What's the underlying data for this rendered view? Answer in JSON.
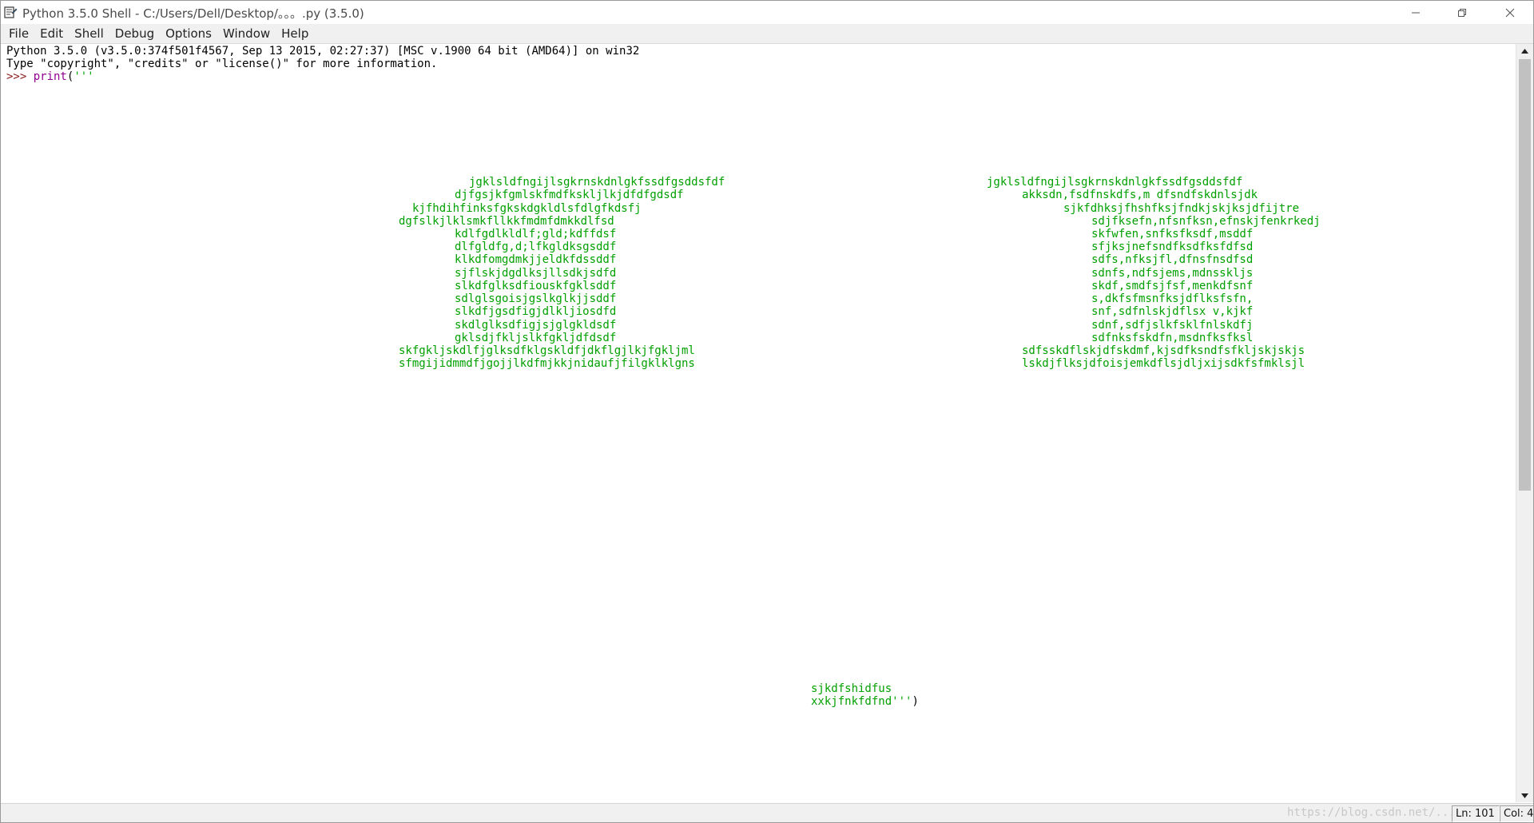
{
  "window": {
    "title": "Python 3.5.0 Shell - C:/Users/Dell/Desktop/。。。.py (3.5.0)"
  },
  "menu": {
    "items": [
      "File",
      "Edit",
      "Shell",
      "Debug",
      "Options",
      "Window",
      "Help"
    ]
  },
  "shell": {
    "banner_1": "Python 3.5.0 (v3.5.0:374f501f4567, Sep 13 2015, 02:27:37) [MSC v.1900 64 bit (AMD64)] on win32",
    "banner_2": "Type \"copyright\", \"credits\" or \"license()\" for more information.",
    "prompt": ">>> ",
    "call_fn": "print",
    "call_open": "(",
    "call_quote": "'''",
    "left_block": [
      "jgklsldfngijlsgkrnskdnlgkfssdfgsddsfdf",
      "djfgsjkfgmlskfmdfkskljlkjdfdfgdsdf",
      "kjfhdihfinksfgkskdgkldlsfdlgfkdsfj",
      "dgfslkjlklsmkfllkkfmdmfdmkkdlfsd",
      "kdlfgdlkldlf;gld;kdffdsf",
      "dlfgldfg,d;lfkgldksgsddf",
      "klkdfomgdmkjjeldkfdssddf",
      "sjflskjdgdlksjllsdkjsdfd",
      "slkdfglksdfiouskfgklsddf",
      "sdlglsgoisjgslkglkjjsddf",
      "slkdfjgsdfigjdlkljiosdfd",
      "skdlglksdfigjsjglgkldsdf",
      "gklsdjfkljslkfgkljdfdsdf",
      "skfgkljskdlfjglksdfklgskldfjdkflgjlkjfgkljml",
      "sfmgijidmmdfjgojjlkdfmjkkjnidaufjfilgklklgns"
    ],
    "right_block": [
      "jgklsldfngijlsgkrnskdnlgkfssdfgsddsfdf",
      "akksdn,fsdfnskdfs,m dfsndfskdnlsjdk",
      "sjkfdhksjfhshfksjfndkjskjksjdfijtre",
      "sdjfksefn,nfsnfksn,efnskjfenkrkedj",
      "skfwfen,snfksfksdf,msddf",
      "sfjksjnefsndfksdfksfdfsd",
      "sdfs,nfksjfl,dfnsfnsdfsd",
      "sdnfs,ndfsjems,mdnsskljs",
      "skdf,smdfsjfsf,menkdfsnf",
      "s,dkfsfmsnfksjdflksfsfn,",
      "snf,sdfnlskjdflsx v,kjkf",
      "sdnf,sdfjslkfsklfnlskdfj",
      "sdfnksfskdfn,msdnfksfksl",
      "sdfsskdflskjdfskdmf,kjsdfksndfsfkljskjskjs",
      "lskdjflksjdfoisjemkdflsjdljxijsdkfsfmklsjl"
    ],
    "tail_1": "sjkdfshidfus",
    "tail_2": "xxkjfnkfdfnd",
    "tail_close_quote": "'''",
    "tail_close_paren": ")"
  },
  "statusbar": {
    "watermark": "https://blog.csdn.net/...",
    "line": "Ln: 101",
    "col": "Col: 4"
  },
  "colors": {
    "string": "#00a000",
    "prompt": "#8b1a1a",
    "builtin": "#900090"
  }
}
